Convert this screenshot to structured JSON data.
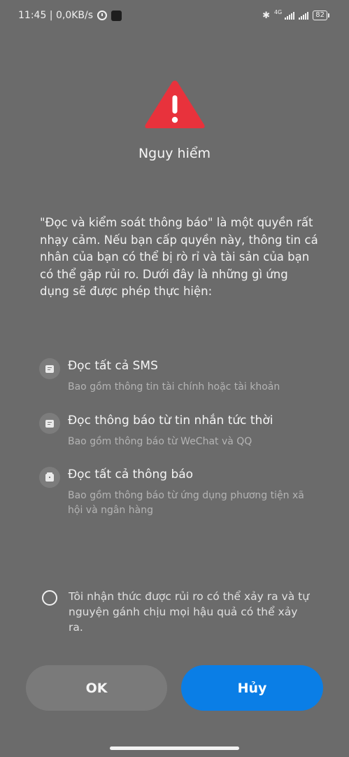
{
  "status_bar": {
    "time_net": "11:45 | 0,0KB/s",
    "network_type": "4G",
    "battery": "82"
  },
  "dialog": {
    "title": "Nguy hiểm",
    "description": "\"Đọc và kiểm soát thông báo\" là một quyền rất nhạy cảm. Nếu bạn cấp quyền này, thông tin cá nhân của bạn có thể bị rò rỉ và tài sản của bạn có thể gặp rủi ro. Dưới đây là những gì ứng dụng sẽ được phép thực hiện:",
    "permissions": [
      {
        "icon": "message-icon",
        "title": "Đọc tất cả SMS",
        "subtitle": "Bao gồm thông tin tài chính hoặc tài khoản"
      },
      {
        "icon": "chat-notification-icon",
        "title": "Đọc thông báo từ tin nhắn tức thời",
        "subtitle": "Bao gồm thông báo từ WeChat và QQ"
      },
      {
        "icon": "bag-icon",
        "title": "Đọc tất cả thông báo",
        "subtitle": "Bao gồm thông báo từ ứng dụng phương tiện xã hội và ngân hàng"
      }
    ],
    "acknowledge": "Tôi nhận thức được rủi ro có thể xảy ra và tự nguyện gánh chịu mọi hậu quả có thể xảy ra.",
    "ok_label": "OK",
    "cancel_label": "Hủy"
  },
  "colors": {
    "background": "#6b6b6b",
    "warning": "#e8323c",
    "primary": "#0a7ee6"
  }
}
